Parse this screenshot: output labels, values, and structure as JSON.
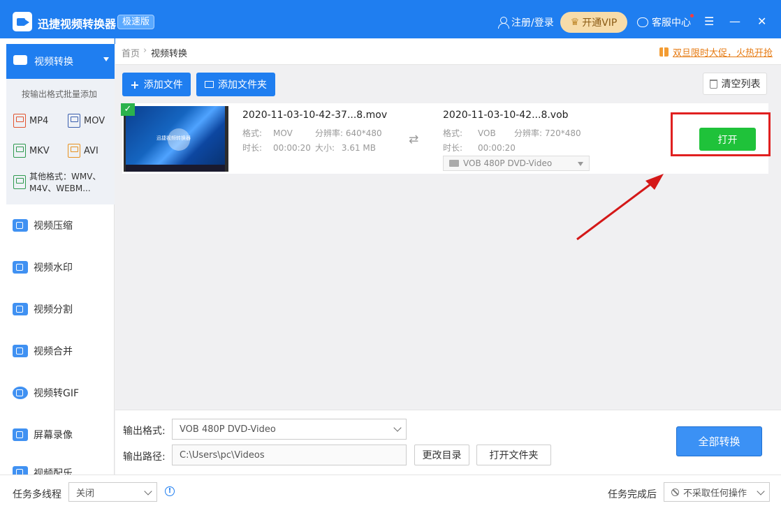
{
  "app": {
    "title": "迅捷视频转换器",
    "edition": "极速版"
  },
  "header": {
    "login": "注册/登录",
    "vip": "开通VIP",
    "service": "客服中心"
  },
  "window_controls": {
    "menu": "☰",
    "minimize": "—",
    "close": "✕"
  },
  "sidebar": {
    "active": "视频转换",
    "batch_hint": "按输出格式批量添加",
    "formats": [
      {
        "label": "MP4",
        "color": "#e2542f"
      },
      {
        "label": "MOV",
        "color": "#3a5fae"
      },
      {
        "label": "MKV",
        "color": "#2f9a4f"
      },
      {
        "label": "AVI",
        "color": "#e8911f"
      }
    ],
    "other_formats_line1": "其他格式：WMV、",
    "other_formats_line2": "M4V、WEBM...",
    "items": [
      "视频压缩",
      "视频水印",
      "视频分割",
      "视频合并",
      "视频转GIF",
      "屏幕录像",
      "视频配乐"
    ]
  },
  "breadcrumb": {
    "home": "首页",
    "sep": "›",
    "current": "视频转换"
  },
  "promo": "双旦限时大促，火热开抢",
  "toolbar": {
    "add_file": "添加文件",
    "add_folder": "添加文件夹",
    "clear_list": "清空列表"
  },
  "file": {
    "source": {
      "name": "2020-11-03-10-42-37...8.mov",
      "format_label": "格式:",
      "format": "MOV",
      "res_label": "分辨率:",
      "resolution": "640*480",
      "dur_label": "时长:",
      "duration": "00:00:20",
      "size_label": "大小:",
      "size": "3.61 MB"
    },
    "output": {
      "name": "2020-11-03-10-42...8.vob",
      "format_label": "格式:",
      "format": "VOB",
      "res_label": "分辨率:",
      "resolution": "720*480",
      "dur_label": "时长:",
      "duration": "00:00:20",
      "preset": "VOB  480P DVD-Video"
    },
    "open": "打开",
    "thumb_text": "迅捷视频转换器"
  },
  "bottom": {
    "out_format_label": "输出格式:",
    "out_format_value": "VOB  480P DVD-Video",
    "out_path_label": "输出路径:",
    "out_path_value": "C:\\Users\\pc\\Videos",
    "change_dir": "更改目录",
    "open_folder": "打开文件夹",
    "convert_all": "全部转换"
  },
  "status": {
    "multithread_label": "任务多线程",
    "multithread_value": "关闭",
    "after_label": "任务完成后",
    "after_value": "不采取任何操作"
  }
}
